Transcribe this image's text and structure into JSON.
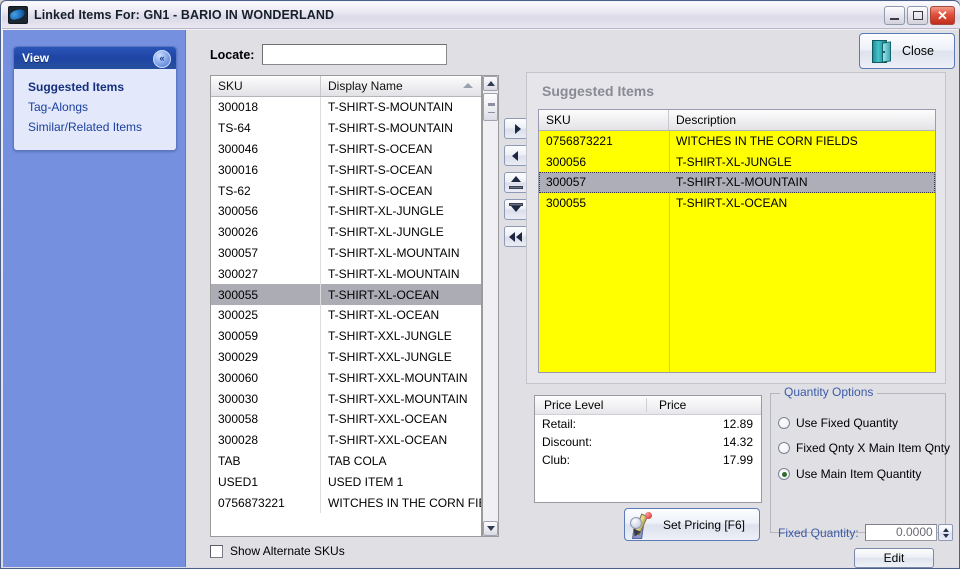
{
  "window": {
    "title": "Linked Items For: GN1 - BARIO IN WONDERLAND",
    "icon": "app-icon",
    "minimize_label": "",
    "maximize_label": "",
    "close_glyph": "✕"
  },
  "sidebar": {
    "header": "View",
    "collapse_glyph": "«",
    "items": [
      {
        "label": "Suggested Items",
        "active": true
      },
      {
        "label": "Tag-Alongs",
        "active": false
      },
      {
        "label": "Similar/Related Items",
        "active": false
      }
    ]
  },
  "toolbar": {
    "close_label": "Close"
  },
  "locate": {
    "label": "Locate:",
    "value": "",
    "placeholder": ""
  },
  "left_grid": {
    "columns": [
      "SKU",
      "Display Name"
    ],
    "sort_column": "Display Name",
    "sort_direction": "ascending",
    "rows": [
      {
        "sku": "300018",
        "name": "T-SHIRT-S-MOUNTAIN",
        "selected": false
      },
      {
        "sku": "TS-64",
        "name": "T-SHIRT-S-MOUNTAIN",
        "selected": false
      },
      {
        "sku": "300046",
        "name": "T-SHIRT-S-OCEAN",
        "selected": false
      },
      {
        "sku": "300016",
        "name": "T-SHIRT-S-OCEAN",
        "selected": false
      },
      {
        "sku": "TS-62",
        "name": "T-SHIRT-S-OCEAN",
        "selected": false
      },
      {
        "sku": "300056",
        "name": "T-SHIRT-XL-JUNGLE",
        "selected": false
      },
      {
        "sku": "300026",
        "name": "T-SHIRT-XL-JUNGLE",
        "selected": false
      },
      {
        "sku": "300057",
        "name": "T-SHIRT-XL-MOUNTAIN",
        "selected": false
      },
      {
        "sku": "300027",
        "name": "T-SHIRT-XL-MOUNTAIN",
        "selected": false
      },
      {
        "sku": "300055",
        "name": "T-SHIRT-XL-OCEAN",
        "selected": true
      },
      {
        "sku": "300025",
        "name": "T-SHIRT-XL-OCEAN",
        "selected": false
      },
      {
        "sku": "300059",
        "name": "T-SHIRT-XXL-JUNGLE",
        "selected": false
      },
      {
        "sku": "300029",
        "name": "T-SHIRT-XXL-JUNGLE",
        "selected": false
      },
      {
        "sku": "300060",
        "name": "T-SHIRT-XXL-MOUNTAIN",
        "selected": false
      },
      {
        "sku": "300030",
        "name": "T-SHIRT-XXL-MOUNTAIN",
        "selected": false
      },
      {
        "sku": "300058",
        "name": "T-SHIRT-XXL-OCEAN",
        "selected": false
      },
      {
        "sku": "300028",
        "name": "T-SHIRT-XXL-OCEAN",
        "selected": false
      },
      {
        "sku": "TAB",
        "name": "TAB COLA",
        "selected": false
      },
      {
        "sku": "USED1",
        "name": "USED ITEM 1",
        "selected": false
      },
      {
        "sku": "0756873221",
        "name": "WITCHES IN THE CORN FIE",
        "selected": false
      }
    ]
  },
  "transfer_buttons": [
    {
      "name": "move-right",
      "glyph": "▶"
    },
    {
      "name": "move-left",
      "glyph": "◀"
    },
    {
      "name": "move-top",
      "glyph": "▲"
    },
    {
      "name": "move-bottom",
      "glyph": "▼"
    },
    {
      "name": "move-all-left",
      "glyph": "◀◀"
    }
  ],
  "show_alternate": {
    "label": "Show Alternate SKUs",
    "checked": false
  },
  "suggested_panel": {
    "title": "Suggested Items",
    "columns": [
      "SKU",
      "Description"
    ],
    "row_highlight_color": "#ffff00",
    "selected_row_color": "#aeaeb8",
    "rows": [
      {
        "sku": "0756873221",
        "description": "WITCHES IN THE CORN FIELDS",
        "selected": false
      },
      {
        "sku": "300056",
        "description": "T-SHIRT-XL-JUNGLE",
        "selected": false
      },
      {
        "sku": "300057",
        "description": "T-SHIRT-XL-MOUNTAIN",
        "selected": true
      },
      {
        "sku": "300055",
        "description": "T-SHIRT-XL-OCEAN",
        "selected": false
      }
    ]
  },
  "price_levels": {
    "columns": [
      "Price Level",
      "Price"
    ],
    "rows": [
      {
        "level": "Retail:",
        "price": "12.89"
      },
      {
        "level": "Discount:",
        "price": "14.32"
      },
      {
        "level": "Club:",
        "price": "17.99"
      }
    ]
  },
  "quantity_options": {
    "legend": "Quantity Options",
    "options": [
      {
        "label": "Use Fixed Quantity",
        "selected": false
      },
      {
        "label": "Fixed Qnty X Main Item Qnty",
        "selected": false
      },
      {
        "label": "Use Main Item Quantity",
        "selected": true
      }
    ],
    "fixed_quantity_label": "Fixed Quantity:",
    "fixed_quantity_value": "0.0000",
    "edit_label": "Edit"
  },
  "set_pricing": {
    "label": "Set Pricing [F6]"
  }
}
